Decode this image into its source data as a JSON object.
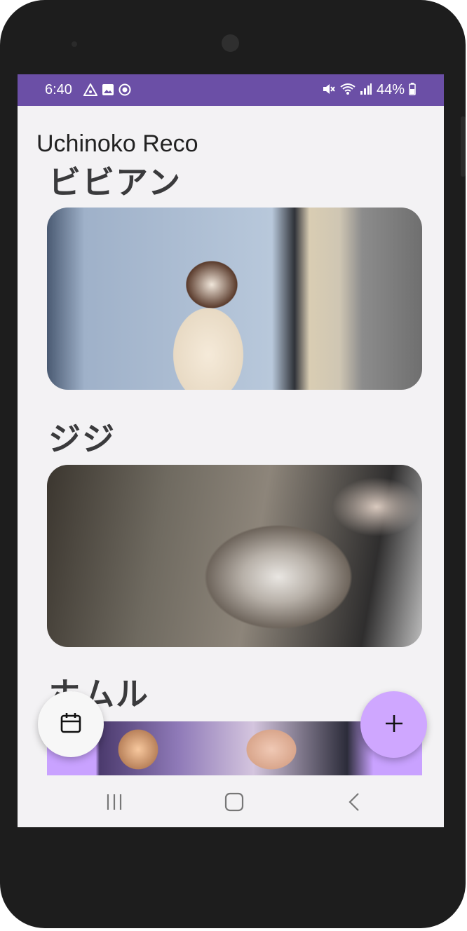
{
  "status_bar": {
    "time": "6:40",
    "battery": "44%",
    "left_icons": [
      "alert-triangle-icon",
      "image-icon",
      "record-icon"
    ],
    "right_icons": [
      "mute-icon",
      "wifi-icon",
      "signal-icon",
      "battery-icon"
    ],
    "color": "#6b4fa6"
  },
  "app": {
    "title": "Uchinoko Reco"
  },
  "cats": [
    {
      "name": "ビビアン"
    },
    {
      "name": "ジジ"
    },
    {
      "name": "ホムル"
    }
  ],
  "fabs": {
    "calendar": "calendar-icon",
    "add": "plus-icon",
    "add_color": "#cfa7ff"
  },
  "nav": {
    "buttons": [
      "recents-icon",
      "home-icon",
      "back-icon"
    ]
  }
}
